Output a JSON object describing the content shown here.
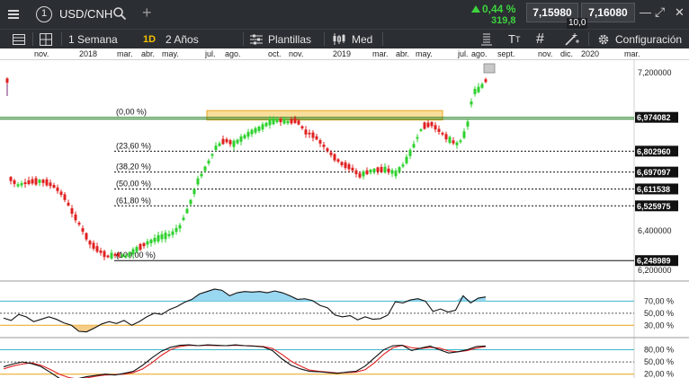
{
  "header": {
    "window_number": "1",
    "symbol": "USD/CNH",
    "change_pct": "0,44 %",
    "change_pts": "319,8",
    "bid": "7,15980",
    "ask": "7,16080",
    "spread": "10,0",
    "colors": {
      "up": "#3ed33e",
      "bar": "#2b2e33"
    }
  },
  "toolbar": {
    "period": "1 Semana",
    "interval_badge": "1D",
    "range": "2 Años",
    "templates": "Plantillas",
    "price_type": "Med",
    "config": "Configuración"
  },
  "time_axis": {
    "labels": [
      "nov.",
      "2018",
      "mar.",
      "abr.",
      "may.",
      "jul.",
      "ago.",
      "oct.",
      "nov.",
      "2019",
      "mar.",
      "abr.",
      "may.",
      "jul.",
      "ago.",
      "sept.",
      "nov.",
      "dic.",
      "2020",
      "mar."
    ]
  },
  "chart_data": {
    "type": "candlestick",
    "price_axis": {
      "range": [
        6.2,
        7.2
      ],
      "tick_labels": [
        "7,200000",
        "6,400000",
        "6,200000"
      ],
      "markers": [
        {
          "label": "6,974082",
          "value": 6.974082,
          "color": "#1f7a1f"
        },
        {
          "label": "6,802960",
          "value": 6.80296
        },
        {
          "label": "6,697097",
          "value": 6.697097
        },
        {
          "label": "6,611538",
          "value": 6.611538
        },
        {
          "label": "6,525975",
          "value": 6.525975
        },
        {
          "label": "6,248989",
          "value": 6.248989
        }
      ]
    },
    "fibonacci": [
      {
        "label": "(0,00 %)",
        "value": 6.974082
      },
      {
        "label": "(23,60 %)",
        "value": 6.80296
      },
      {
        "label": "(38,20 %)",
        "value": 6.697097
      },
      {
        "label": "(50,00 %)",
        "value": 6.611538
      },
      {
        "label": "(61,80 %)",
        "value": 6.525975
      },
      {
        "label": "(100,00 %)",
        "value": 6.248989
      }
    ],
    "resistance_zone": {
      "from": 6.97,
      "to": 6.99
    },
    "colors": {
      "up": "#2ed12e",
      "down": "#e02020",
      "zone_fill": "#f7d98a",
      "zone_edge": "#e8a317"
    },
    "indicator1": {
      "tick_labels": [
        "70,00 %",
        "50,00 %",
        "30,00 %"
      ],
      "levels": [
        70,
        50,
        30
      ],
      "values": [
        42,
        38,
        48,
        44,
        36,
        40,
        44,
        40,
        34,
        30,
        20,
        19,
        25,
        32,
        36,
        33,
        38,
        30,
        36,
        44,
        50,
        48,
        56,
        61,
        68,
        73,
        82,
        86,
        90,
        88,
        79,
        84,
        86,
        85,
        86,
        84,
        87,
        84,
        79,
        73,
        74,
        71,
        63,
        59,
        47,
        44,
        46,
        39,
        44,
        40,
        41,
        47,
        69,
        67,
        72,
        74,
        70,
        53,
        57,
        52,
        55,
        79,
        67,
        75,
        77
      ]
    },
    "indicator2": {
      "tick_labels": [
        "80,00 %",
        "50,00 %",
        "20,00 %"
      ],
      "levels": [
        80,
        50,
        20
      ],
      "k": [
        38,
        45,
        50,
        46,
        39,
        25,
        10,
        6,
        9,
        14,
        17,
        20,
        18,
        22,
        27,
        42,
        60,
        76,
        86,
        91,
        92,
        90,
        92,
        91,
        90,
        92,
        90,
        89,
        87,
        78,
        58,
        42,
        33,
        27,
        26,
        24,
        22,
        25,
        27,
        40,
        60,
        80,
        90,
        91,
        78,
        84,
        89,
        80,
        72,
        75,
        80,
        88,
        89
      ],
      "d": [
        33,
        40,
        45,
        48,
        42,
        32,
        20,
        12,
        8,
        11,
        15,
        18,
        19,
        20,
        24,
        33,
        48,
        66,
        80,
        88,
        91,
        90,
        91,
        90,
        90,
        91,
        90,
        89,
        88,
        83,
        69,
        52,
        40,
        30,
        27,
        25,
        23,
        24,
        25,
        31,
        48,
        69,
        85,
        91,
        85,
        83,
        86,
        84,
        77,
        75,
        78,
        84,
        88
      ],
      "colors": {
        "k": "#111111",
        "d": "#e02020"
      }
    }
  }
}
